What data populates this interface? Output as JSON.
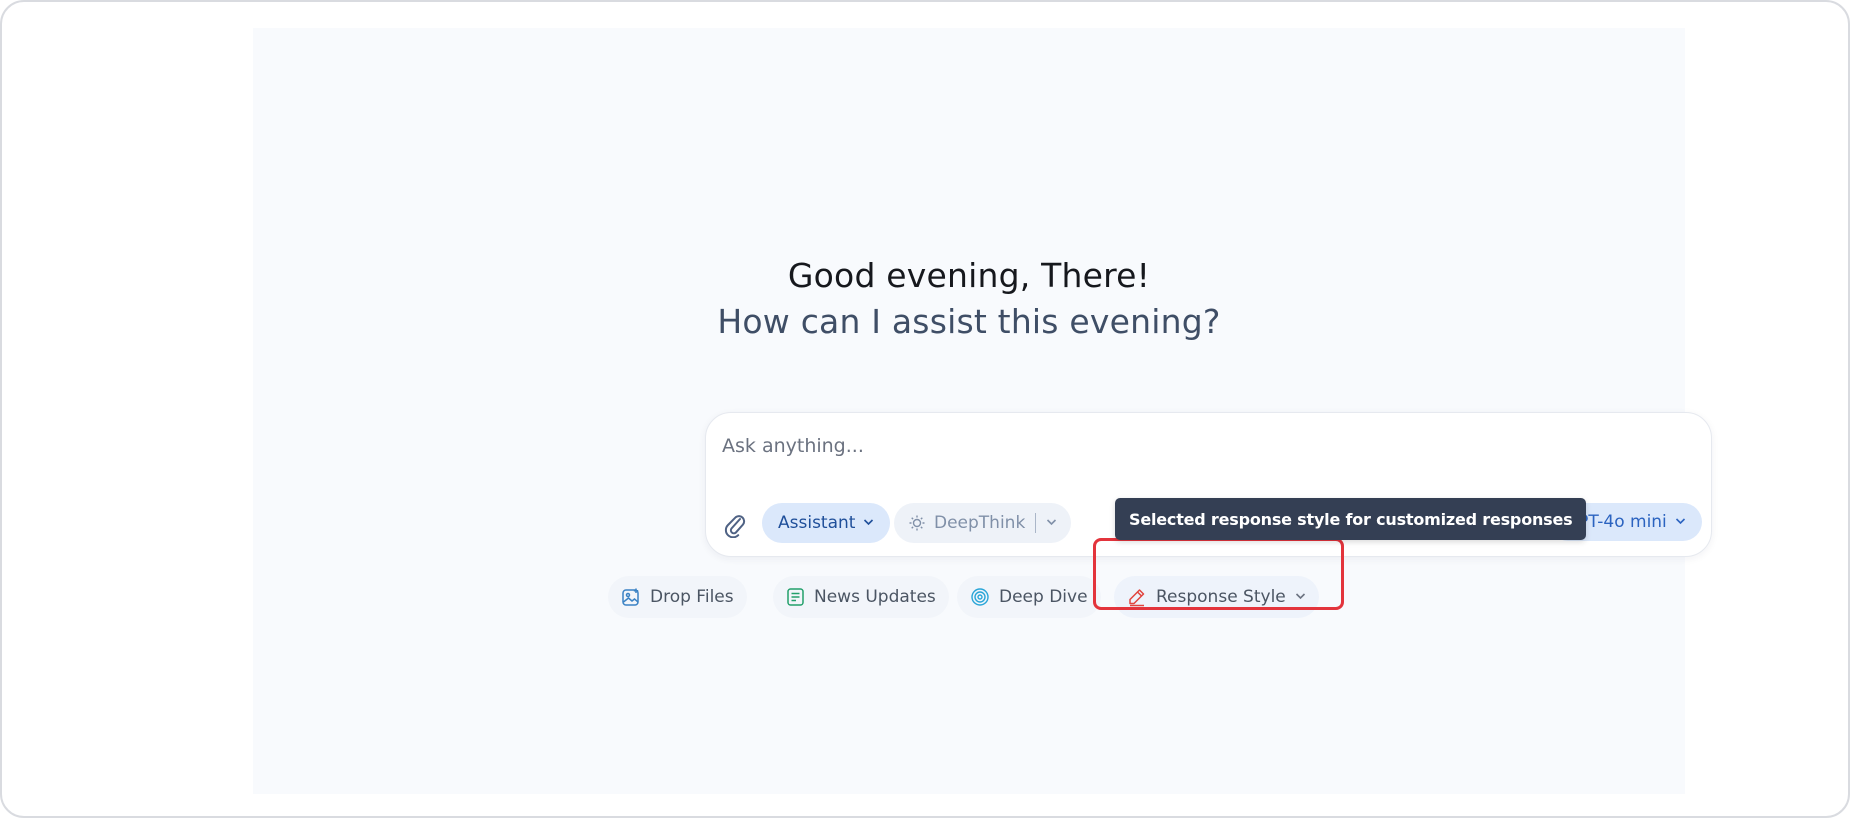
{
  "hero": {
    "greeting": "Good evening, There!",
    "subtitle": "How can I assist this evening?"
  },
  "composer": {
    "placeholder": "Ask anything...",
    "attach_icon": "paperclip-icon",
    "assistant_label": "Assistant",
    "deepthink_label": "DeepThink",
    "model_label": "GPT-4o mini"
  },
  "tooltip": {
    "text": "Selected response style for customized responses"
  },
  "actions": {
    "drop_files": "Drop Files",
    "news_updates": "News Updates",
    "deep_dive": "Deep Dive",
    "response_style": "Response Style"
  },
  "colors": {
    "canvas_bg": "#f8fafd",
    "accent_blue": "#2b63c0",
    "pill_blue_bg": "#dbe8fb",
    "tooltip_bg": "#343f54",
    "highlight_red": "#e3343c",
    "news_icon_green": "#22a06b",
    "dive_icon_cyan": "#2aa6d8",
    "style_icon_red": "#e0443e"
  }
}
